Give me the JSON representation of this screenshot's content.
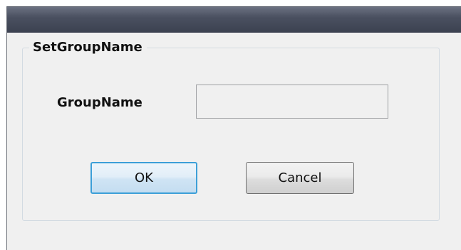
{
  "dialog": {
    "group_title": "SetGroupName",
    "field_label": "GroupName",
    "group_name_value": "",
    "ok_label": "OK",
    "cancel_label": "Cancel"
  }
}
